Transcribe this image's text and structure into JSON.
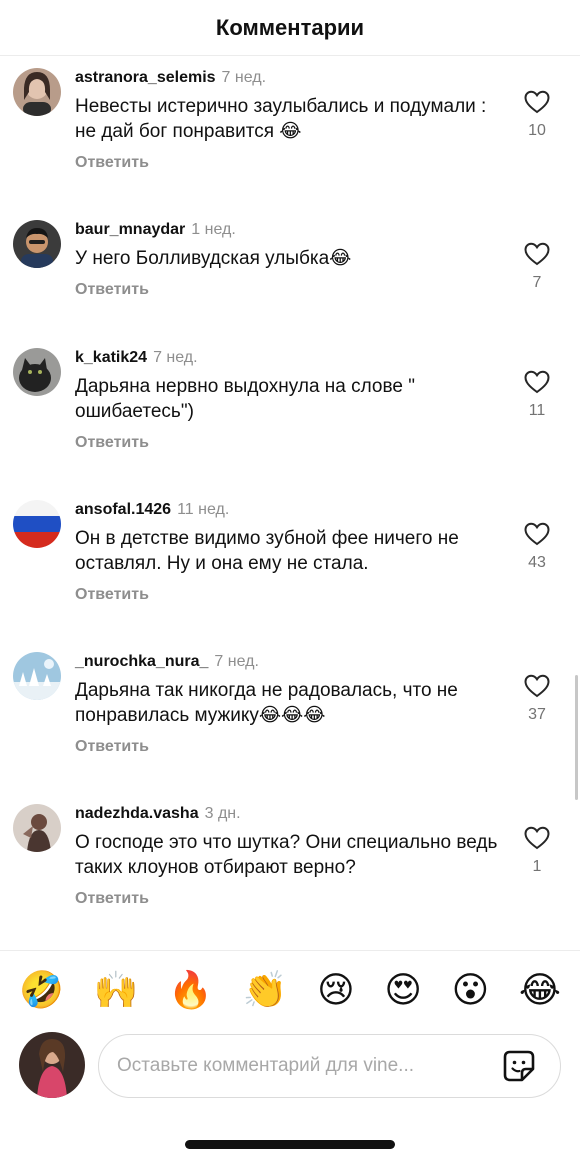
{
  "header": {
    "title": "Комментарии"
  },
  "comments": [
    {
      "username": "astranora_selemis",
      "time": "7 нед.",
      "text": "Невесты истерично заулыбались и подумали : не дай бог понравится 😂",
      "reply": "Ответить",
      "likes": "10"
    },
    {
      "username": "baur_mnaydar",
      "time": "1 нед.",
      "text": "У него Болливудская улыбка😂",
      "reply": "Ответить",
      "likes": "7"
    },
    {
      "username": "k_katik24",
      "time": "7 нед.",
      "text": "Дарьяна нервно выдохнула на слове \" ошибаетесь\")",
      "reply": "Ответить",
      "likes": "11"
    },
    {
      "username": "ansofal.1426",
      "time": "11 нед.",
      "text": "Он в детстве видимо зубной фее ничего не оставлял. Ну и она ему не стала.",
      "reply": "Ответить",
      "likes": "43"
    },
    {
      "username": "_nurochka_nura_",
      "time": "7 нед.",
      "text": "Дарьяна так никогда не радовалась, что не понравилась мужику😂😂😂",
      "reply": "Ответить",
      "likes": "37"
    },
    {
      "username": "nadezhda.vasha",
      "time": "3 дн.",
      "text": "О господе это что шутка? Они специально ведь таких клоунов отбирают верно?",
      "reply": "Ответить",
      "likes": "1"
    }
  ],
  "emoji_bar": [
    "🤣",
    "🙌",
    "🔥",
    "👏",
    "😢",
    "😍",
    "😮",
    "😂"
  ],
  "composer": {
    "placeholder": "Оставьте комментарий для vine...",
    "sticker_icon": "sticker-icon"
  },
  "colors": {
    "muted": "#8e8e8e",
    "border": "#dbdbdb",
    "text": "#111111"
  }
}
